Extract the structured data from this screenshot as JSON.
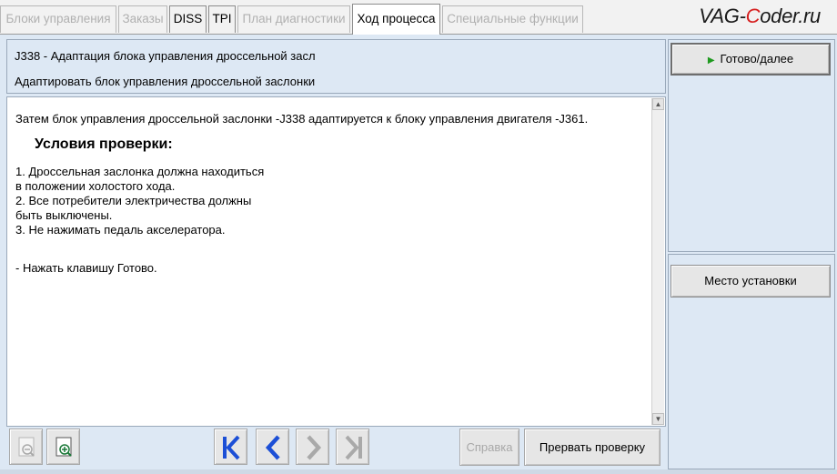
{
  "tabs": [
    {
      "label": "Блоки управления",
      "state": "disabled"
    },
    {
      "label": "Заказы",
      "state": "disabled"
    },
    {
      "label": "DISS",
      "state": "enabled"
    },
    {
      "label": "TPI",
      "state": "enabled"
    },
    {
      "label": "План диагностики",
      "state": "disabled"
    },
    {
      "label": "Ход процесса",
      "state": "active"
    },
    {
      "label": "Специальные функции",
      "state": "disabled"
    }
  ],
  "brand": {
    "prefix": "VAG-",
    "highlight": "C",
    "suffix": "oder.ru"
  },
  "header": {
    "title": "J338 - Адаптация блока управления дроссельной засл",
    "subtitle": "Адаптировать блок управления дроссельной заслонки"
  },
  "content": {
    "intro": "Затем блок управления дроссельной заслонки -J338 адаптируется к блоку управления двигателя -J361.",
    "heading": "Условия проверки:",
    "lines": [
      "1. Дроссельная заслонка должна находиться",
      "в положении холостого хода.",
      "2. Все потребители электричества  должны",
      "быть выключены.",
      "3. Не нажимать педаль акселератора."
    ],
    "instruction": "- Нажать клавишу Готово."
  },
  "side": {
    "ready_label": "Готово/далее",
    "location_label": "Место установки"
  },
  "toolbar": {
    "help_label": "Справка",
    "abort_label": "Прервать проверку"
  },
  "colors": {
    "panel_bg": "#dde8f4",
    "nav_blue": "#1c4fd6",
    "nav_disabled": "#a9a9a9",
    "play_green": "#1f9a1f",
    "brand_red": "#d62020"
  }
}
